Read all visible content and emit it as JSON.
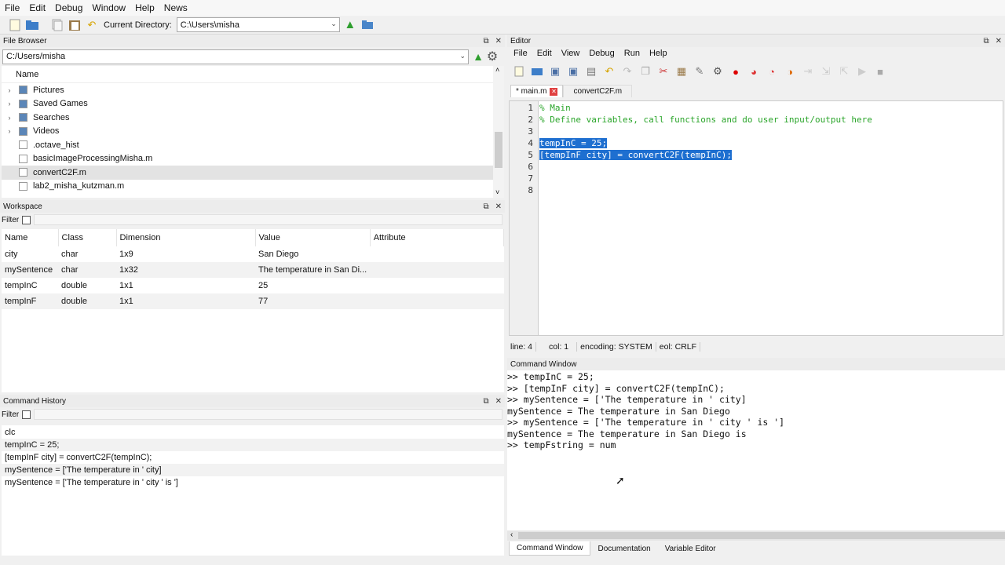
{
  "menubar": [
    "File",
    "Edit",
    "Debug",
    "Window",
    "Help",
    "News"
  ],
  "toolbar": {
    "current_dir_label": "Current Directory:",
    "current_dir_value": "C:\\Users\\misha"
  },
  "file_browser": {
    "title": "File Browser",
    "path": "C:/Users/misha",
    "column": "Name",
    "items": [
      {
        "name": "Pictures",
        "icon": "folder-pictures-icon",
        "expandable": true
      },
      {
        "name": "Saved Games",
        "icon": "folder-icon",
        "expandable": true
      },
      {
        "name": "Searches",
        "icon": "search-folder-icon",
        "expandable": true
      },
      {
        "name": "Videos",
        "icon": "folder-video-icon",
        "expandable": true
      },
      {
        "name": ".octave_hist",
        "icon": "file-icon",
        "expandable": false
      },
      {
        "name": "basicImageProcessingMisha.m",
        "icon": "m-file-icon",
        "expandable": false
      },
      {
        "name": "convertC2F.m",
        "icon": "m-file-icon",
        "expandable": false,
        "selected": true
      },
      {
        "name": "lab2_misha_kutzman.m",
        "icon": "m-file-icon",
        "expandable": false
      }
    ]
  },
  "workspace": {
    "title": "Workspace",
    "filter_label": "Filter",
    "columns": [
      "Name",
      "Class",
      "Dimension",
      "Value",
      "Attribute"
    ],
    "rows": [
      [
        "city",
        "char",
        "1x9",
        "San Diego",
        ""
      ],
      [
        "mySentence",
        "char",
        "1x32",
        "The temperature in San Di...",
        ""
      ],
      [
        "tempInC",
        "double",
        "1x1",
        "25",
        ""
      ],
      [
        "tempInF",
        "double",
        "1x1",
        "77",
        ""
      ]
    ]
  },
  "history": {
    "title": "Command History",
    "filter_label": "Filter",
    "items": [
      "clc",
      "tempInC = 25;",
      "[tempInF city] = convertC2F(tempInC);",
      "mySentence = ['The temperature in ' city]",
      "mySentence = ['The temperature in ' city ' is ']"
    ]
  },
  "editor": {
    "title": "Editor",
    "menu": [
      "File",
      "Edit",
      "View",
      "Debug",
      "Run",
      "Help"
    ],
    "tabs": [
      {
        "label": "* main.m",
        "active": true
      },
      {
        "label": "convertC2F.m",
        "active": false
      }
    ],
    "lines": [
      {
        "n": "1",
        "text": "% Main",
        "type": "comment"
      },
      {
        "n": "2",
        "text": "% Define variables, call functions and do user input/output here",
        "type": "comment"
      },
      {
        "n": "3",
        "text": "",
        "type": "code"
      },
      {
        "n": "4",
        "text": "tempInC = 25;",
        "type": "selected"
      },
      {
        "n": "5",
        "text": "[tempInF city] = convertC2F(tempInC);",
        "type": "selected"
      },
      {
        "n": "6",
        "text": "",
        "type": "code"
      },
      {
        "n": "7",
        "text": "",
        "type": "code"
      },
      {
        "n": "8",
        "text": "",
        "type": "code"
      }
    ],
    "status": {
      "line": "line: 4",
      "col": "col: 1",
      "encoding": "encoding: SYSTEM",
      "eol": "eol: CRLF"
    }
  },
  "command_window": {
    "title": "Command Window",
    "lines": [
      ">> tempInC = 25;",
      ">> [tempInF city] = convertC2F(tempInC);",
      ">> mySentence = ['The temperature in ' city]",
      "mySentence = The temperature in San Diego",
      ">> mySentence = ['The temperature in ' city ' is ']",
      "mySentence = The temperature in San Diego is",
      ">> tempFstring = num"
    ],
    "bottom_tabs": [
      "Command Window",
      "Documentation",
      "Variable Editor"
    ]
  },
  "colors": {
    "selection": "#1e6fd0",
    "comment": "#2aa52a",
    "panel_bg": "#f0f0f0"
  }
}
